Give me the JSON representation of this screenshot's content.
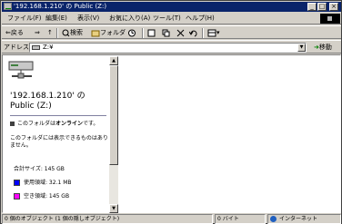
{
  "window": {
    "title": "'192.168.1.210' の Public (Z:)",
    "minimize": "_",
    "maximize": "□",
    "close": "×"
  },
  "menu": [
    "ファイル(F)",
    "編集(E)",
    "表示(V)",
    "お気に入り(A)",
    "ツール(T)",
    "ヘルプ(H)"
  ],
  "toolbar": {
    "back": "⇐戻る",
    "forward": "⇒",
    "up": "↑",
    "search": "検索",
    "folders": "フォルダ",
    "views": "▾"
  },
  "address": {
    "label": "アドレス(D)",
    "value": "Z:¥",
    "go_label": "移動"
  },
  "leftpane": {
    "title_line1": "'192.168.1.210' の",
    "title_line2": "Public (Z:)",
    "online_prefix": "このフォルダは",
    "online_bold": "オンライン",
    "online_suffix": "です。",
    "note": "このフォルダには表示できるものはありません。",
    "total": "合計サイズ: 145 GB",
    "used": "使用領域: 32.1 MB",
    "free": "空き領域: 145 GB",
    "used_color": "#0000ff",
    "free_color": "#ff00ff"
  },
  "status": {
    "objects": "0 個のオブジェクト (1 個の隠しオブジェクト)",
    "size": "0 バイト",
    "zone": "インターネット"
  }
}
